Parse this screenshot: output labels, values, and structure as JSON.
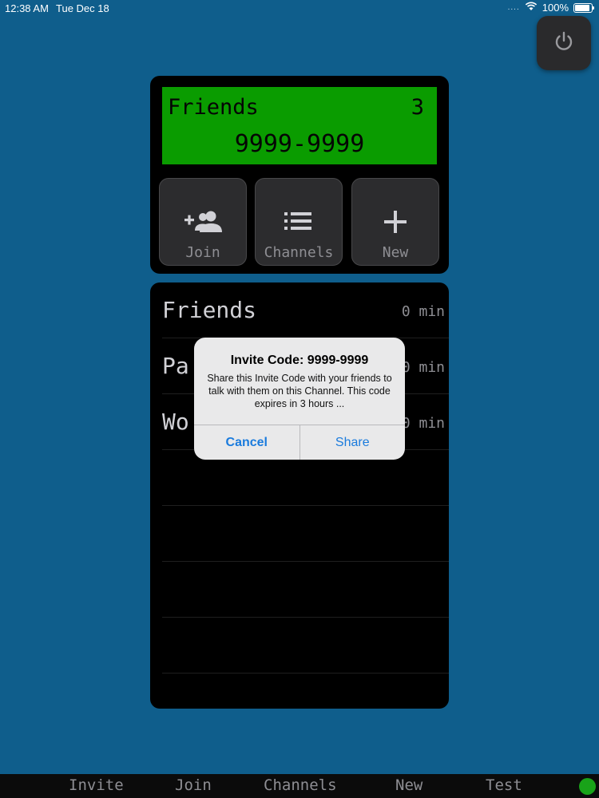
{
  "status_bar": {
    "time": "12:38 AM",
    "date": "Tue Dec 18",
    "signal_dots": "....",
    "battery_text": "100%",
    "battery_level": 1.0
  },
  "power_button": {
    "icon": "power-icon"
  },
  "display": {
    "channel_name": "Friends",
    "member_count": "3",
    "code": "9999-9999",
    "background_color": "#0a9c00"
  },
  "actions": [
    {
      "label": "Join",
      "icon": "add-user-icon"
    },
    {
      "label": "Channels",
      "icon": "list-icon"
    },
    {
      "label": "New",
      "icon": "plus-icon"
    }
  ],
  "channels": [
    {
      "name": "Friends",
      "time": "0 min"
    },
    {
      "name": "Pa",
      "time": "0 min"
    },
    {
      "name": "Wo",
      "time": "0 min"
    }
  ],
  "alert": {
    "title": "Invite Code: 9999-9999",
    "message": "Share this Invite Code with your friends to talk with them on this Channel.  This code expires in 3 hours ...",
    "cancel_label": "Cancel",
    "share_label": "Share",
    "accent_color": "#1a7bdd"
  },
  "tab_bar": {
    "items": [
      "Invite",
      "Join",
      "Channels",
      "New",
      "Test"
    ],
    "status_color": "#19a319"
  }
}
